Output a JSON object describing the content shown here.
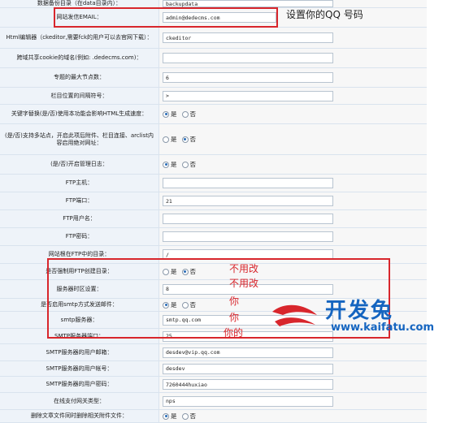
{
  "rows": [
    {
      "label": "数据备份目录（在data目录内）：",
      "value": "backupdata"
    },
    {
      "label": "网站发信EMAIL：",
      "value": "admin@dedecms.com"
    },
    {
      "label": "Html编辑器（ckeditor,需要fck的用户可以去官网下载）：",
      "value": "ckeditor"
    },
    {
      "label": "跨域共享cookie的域名(例如: .dedecms.com)：",
      "value": ""
    },
    {
      "label": "专题的最大节点数：",
      "value": "6"
    },
    {
      "label": "栏目位置的间隔符号：",
      "value": ">"
    },
    {
      "label": "关键字替换(是/否)使用本功能会影响HTML生成速度：",
      "opt_yes": "是",
      "opt_no": "否"
    },
    {
      "label": "(是/否)支持多站点，开启此项后附件、栏目连接、arclist内容启用绝对网址：",
      "opt_yes": "是",
      "opt_no": "否"
    },
    {
      "label": "(是/否)开启管理日志：",
      "opt_yes": "是",
      "opt_no": "否"
    },
    {
      "label": "FTP主机：",
      "value": ""
    },
    {
      "label": "FTP端口：",
      "value": "21"
    },
    {
      "label": "FTP用户名：",
      "value": ""
    },
    {
      "label": "FTP密码：",
      "value": ""
    },
    {
      "label": "网站根在FTP中的目录：",
      "value": "/"
    },
    {
      "label": "是否强制用FTP创建目录：",
      "opt_yes": "是",
      "opt_no": "否"
    },
    {
      "label": "服务器时区设置：",
      "value": "8"
    },
    {
      "label": "是否启用smtp方式发送邮件：",
      "opt_yes": "是",
      "opt_no": "否"
    },
    {
      "label": "smtp服务器：",
      "value": "smtp.qq.com"
    },
    {
      "label": "SMTP服务器端口：",
      "value": "25"
    },
    {
      "label": "SMTP服务器的用户邮箱：",
      "value": "desdev@vip.qq.com"
    },
    {
      "label": "SMTP服务器的用户帐号：",
      "value": "desdev"
    },
    {
      "label": "SMTP服务器的用户密码：",
      "value": "7260444huxiao"
    },
    {
      "label": "在线支付网关类型：",
      "value": "nps"
    },
    {
      "label": "删除文章文件同时删除相关附件文件：",
      "opt_yes": "是",
      "opt_no": "否"
    }
  ],
  "annotations": {
    "email_note": "设置你的QQ 号码",
    "no_change_1": "不用改",
    "no_change_2": "不用改",
    "yours_1": "你",
    "yours_2": "你",
    "yours_3": "你的"
  },
  "watermark": {
    "brand": "开发兔",
    "url": "www.kaifatu.com"
  },
  "colors": {
    "highlight_border": "#d8262c",
    "brand": "#1565c0",
    "radio_on": "#2a6db8"
  }
}
